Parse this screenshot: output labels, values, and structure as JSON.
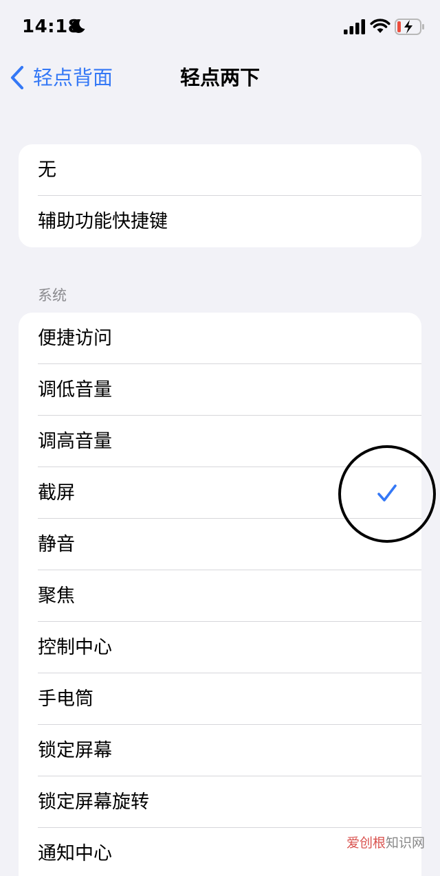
{
  "status_bar": {
    "time": "14:18",
    "icons": [
      "moon-icon",
      "signal-icon",
      "wifi-icon",
      "battery-charging-icon"
    ]
  },
  "nav": {
    "back_label": "轻点背面",
    "title": "轻点两下"
  },
  "group_top": {
    "items": [
      {
        "label": "无",
        "selected": false
      },
      {
        "label": "辅助功能快捷键",
        "selected": false
      }
    ]
  },
  "section_system": {
    "header": "系统",
    "items": [
      {
        "label": "便捷访问",
        "selected": false
      },
      {
        "label": "调低音量",
        "selected": false
      },
      {
        "label": "调高音量",
        "selected": false
      },
      {
        "label": "截屏",
        "selected": true
      },
      {
        "label": "静音",
        "selected": false
      },
      {
        "label": "聚焦",
        "selected": false
      },
      {
        "label": "控制中心",
        "selected": false
      },
      {
        "label": "手电筒",
        "selected": false
      },
      {
        "label": "锁定屏幕",
        "selected": false
      },
      {
        "label": "锁定屏幕旋转",
        "selected": false
      },
      {
        "label": "通知中心",
        "selected": false
      }
    ]
  },
  "watermark": {
    "part1": "爱创根",
    "part2": "知识网"
  },
  "colors": {
    "accent": "#3478f6",
    "background": "#f2f2f7",
    "battery_low": "#eb4d3d"
  }
}
